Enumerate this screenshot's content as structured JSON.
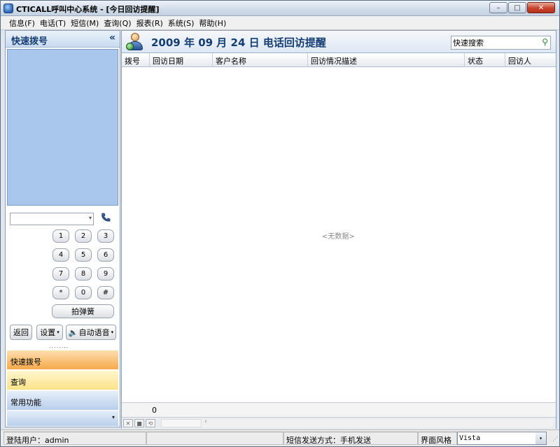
{
  "window": {
    "title": "CTICALL呼叫中心系统 - [今日回访提醒]",
    "controls": {
      "minimize": "–",
      "maximize": "□",
      "close": "✕"
    }
  },
  "menu": {
    "items": [
      "信息(F)",
      "电话(T)",
      "短信(M)",
      "查询(Q)",
      "报表(R)",
      "系统(S)",
      "帮助(H)"
    ]
  },
  "left_panel": {
    "title": "快速拨号",
    "collapse_glyph": "«",
    "dial_combo": {
      "value": "",
      "arrow": "▾"
    },
    "keypad": [
      "1",
      "2",
      "3",
      "4",
      "5",
      "6",
      "7",
      "8",
      "9",
      "*",
      "0",
      "#"
    ],
    "hook_button": "拍弹簧",
    "back_button": "返回",
    "settings_button": "设置",
    "auto_voice_button": "自动语音",
    "splitter": "........",
    "nav": {
      "quick_dial": "快速拨号",
      "query": "查询",
      "common": "常用功能",
      "scroll_arrow": "▾"
    }
  },
  "main": {
    "title": "2009 年 09 月 24 日  电话回访提醒",
    "search": {
      "placeholder": "快速搜索",
      "value": "快速搜索"
    },
    "columns": [
      "拨号",
      "回访日期",
      "客户名称",
      "回访情况描述",
      "状态",
      "回访人"
    ],
    "empty_text": "<无数据>",
    "footer_count": "0",
    "nav_buttons": [
      "✕",
      "■",
      "⟲"
    ],
    "scroll_left": "‹"
  },
  "statusbar": {
    "login_user": "登陆用户：admin",
    "sms_mode": "短信发送方式：手机发送",
    "skin_label": "界面风格",
    "skin_value": "Vista",
    "skin_arrow": "▾"
  },
  "colors": {
    "accent": "#143d73",
    "dial_area": "#a9c6ec",
    "nav_orange": "#f6a94a",
    "nav_yellow": "#fbe38b"
  }
}
